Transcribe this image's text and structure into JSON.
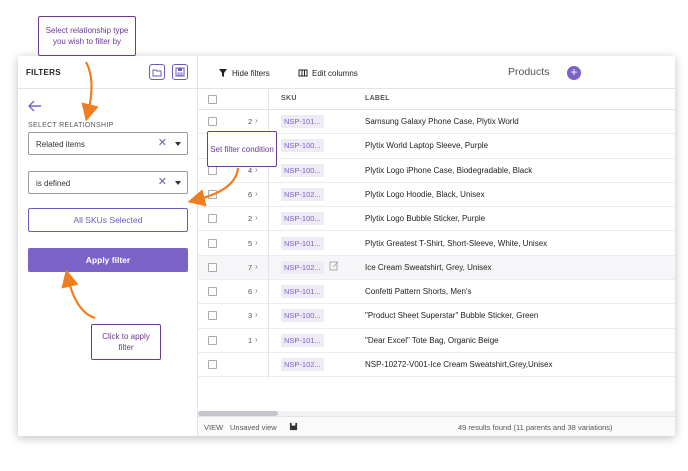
{
  "callouts": {
    "relationship": "Select relationship type you wish to filter by",
    "condition": "Set filter condition",
    "apply": "Click to apply filter"
  },
  "sidebar": {
    "title": "FILTERS",
    "select_label": "SELECT RELATIONSHIP",
    "relationship_value": "Related items",
    "condition_value": "is defined",
    "skus_button": "All SKUs Selected",
    "apply_button": "Apply filter",
    "clear_glyph": "✕"
  },
  "toolbar": {
    "hide_filters": "Hide filters",
    "edit_columns": "Edit columns",
    "title": "Products",
    "add_glyph": "+"
  },
  "table": {
    "headers": {
      "sku": "SKU",
      "label": "LABEL"
    },
    "rows": [
      {
        "count": "2",
        "chevron": "›",
        "sku": "NSP-101...",
        "label": "Samsung Galaxy Phone Case, Plytix World"
      },
      {
        "count": "",
        "chevron": "",
        "sku": "NSP-100...",
        "label": "Plytix World Laptop Sleeve, Purple"
      },
      {
        "count": "4",
        "chevron": "›",
        "sku": "NSP-100...",
        "label": "Plytix Logo iPhone Case, Biodegradable, Black"
      },
      {
        "count": "6",
        "chevron": "›",
        "sku": "NSP-102...",
        "label": "Plytix Logo Hoodie, Black, Unisex"
      },
      {
        "count": "2",
        "chevron": "›",
        "sku": "NSP-100...",
        "label": "Plytix Logo Bubble Sticker, Purple"
      },
      {
        "count": "5",
        "chevron": "›",
        "sku": "NSP-101...",
        "label": "Plytix Greatest T-Shirt, Short-Sleeve, White, Unisex"
      },
      {
        "count": "7",
        "chevron": "›",
        "sku": "NSP-102...",
        "label": "Ice Cream Sweatshirt, Grey, Unisex"
      },
      {
        "count": "6",
        "chevron": "›",
        "sku": "NSP-101...",
        "label": "Confetti Pattern Shorts, Men's"
      },
      {
        "count": "3",
        "chevron": "›",
        "sku": "NSP-100...",
        "label": "\"Product Sheet Superstar\" Bubble Sticker, Green"
      },
      {
        "count": "1",
        "chevron": "›",
        "sku": "NSP-101...",
        "label": "\"Dear Excel\" Tote Bag, Organic Beige"
      },
      {
        "count": "",
        "chevron": "",
        "sku": "NSP-102...",
        "label": "NSP-10272-V001-Ice Cream Sweatshirt,Grey,Unisex"
      }
    ]
  },
  "footer": {
    "view_label": "VIEW",
    "view_value": "Unsaved view",
    "results": "49 results found (11 parents and 38 variations)"
  },
  "colors": {
    "accent": "#7b63c7",
    "callout_border": "#6b3a93",
    "arrow": "#f07e1e"
  },
  "icons": [
    "back-arrow-icon",
    "folder-icon",
    "save-icon",
    "filter-icon",
    "columns-icon",
    "plus-icon",
    "edit-icon",
    "clear-icon",
    "caret-down-icon",
    "chevron-right-icon"
  ]
}
